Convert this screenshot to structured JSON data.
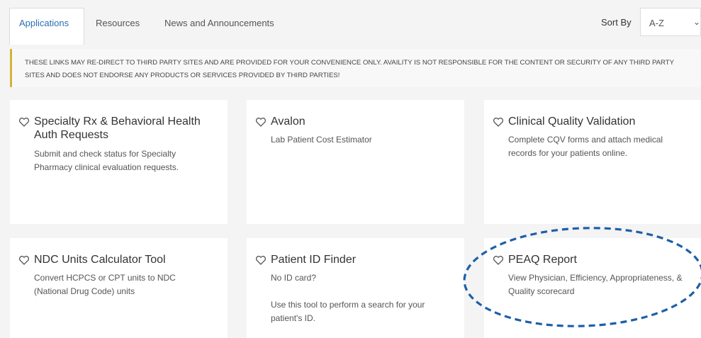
{
  "tabs": [
    {
      "label": "Applications",
      "active": true
    },
    {
      "label": "Resources",
      "active": false
    },
    {
      "label": "News and Announcements",
      "active": false
    }
  ],
  "sort": {
    "label": "Sort By",
    "value": "A-Z"
  },
  "notice": {
    "text": "These links may re-direct to third party sites and are provided for your convenience only. Availity is not responsible for the content or security of any third party sites and does not endorse any products or services provided by third parties!"
  },
  "cards": [
    {
      "title": "Specialty Rx & Behavioral Health Auth Requests",
      "desc": "Submit and check status for Specialty Pharmacy clinical evaluation requests."
    },
    {
      "title": "Avalon",
      "desc": "Lab Patient Cost Estimator"
    },
    {
      "title": "Clinical Quality Validation",
      "desc": "Complete CQV forms and attach medical records for your patients online."
    },
    {
      "title": "NDC Units Calculator Tool",
      "desc": "Convert HCPCS or CPT units to NDC (National Drug Code) units"
    },
    {
      "title": "Patient ID Finder",
      "desc": "No ID card?",
      "desc2": "Use this tool to perform a search for your patient's ID."
    },
    {
      "title": "PEAQ Report",
      "desc": "View Physician, Efficiency, Appropriateness, & Quality scorecard"
    }
  ],
  "colors": {
    "accent": "#2c6fb3",
    "notice_bar": "#d6b23a",
    "highlight_oval": "#1d5fa8"
  }
}
